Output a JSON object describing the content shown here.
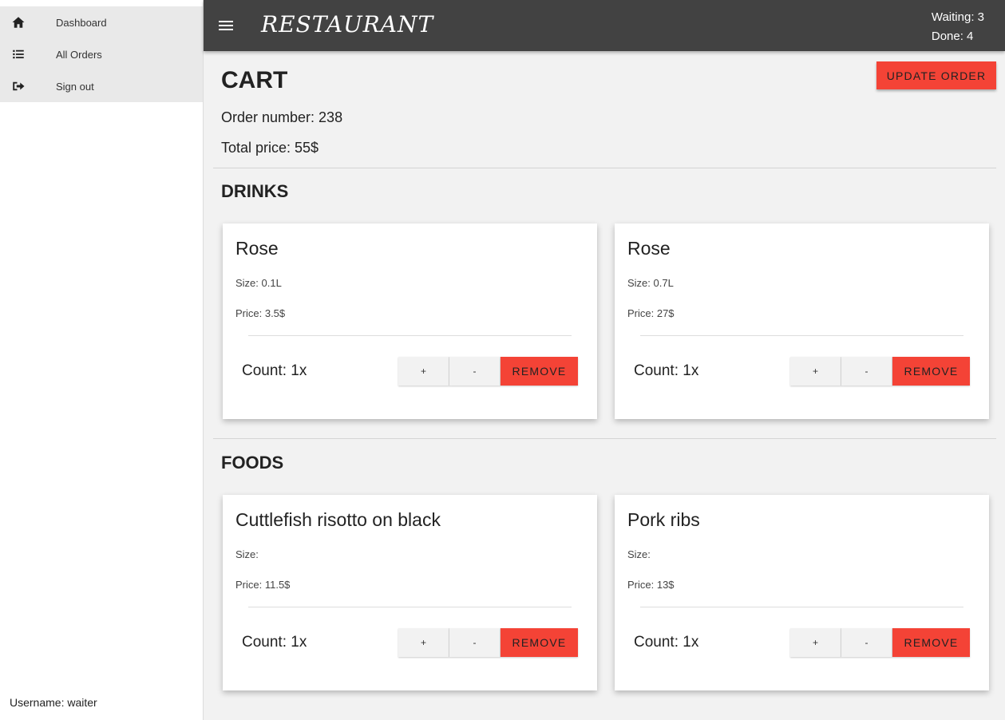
{
  "sidebar": {
    "items": [
      {
        "label": "Dashboard",
        "icon": "home-icon"
      },
      {
        "label": "All Orders",
        "icon": "list-icon"
      },
      {
        "label": "Sign out",
        "icon": "sign-out-icon"
      }
    ],
    "username": "Username: waiter"
  },
  "header": {
    "brand": "RESTAURANT",
    "waiting": "Waiting: 3",
    "done": "Done: 4"
  },
  "cart": {
    "title": "CART",
    "update_label": "UPDATE ORDER",
    "order_number": "Order number: 238",
    "total_price": "Total price: 55$"
  },
  "drinks": {
    "title": "DRINKS",
    "items": [
      {
        "name": "Rose",
        "size": "Size: 0.1L",
        "price": "Price: 3.5$",
        "count": "Count: 1x"
      },
      {
        "name": "Rose",
        "size": "Size: 0.7L",
        "price": "Price: 27$",
        "count": "Count: 1x"
      }
    ]
  },
  "foods": {
    "title": "FOODS",
    "items": [
      {
        "name": "Cuttlefish risotto on black",
        "size": "Size:",
        "price": "Price: 11.5$",
        "count": "Count: 1x"
      },
      {
        "name": "Pork ribs",
        "size": "Size:",
        "price": "Price: 13$",
        "count": "Count: 1x"
      }
    ]
  },
  "buttons": {
    "plus": "+",
    "minus": "-",
    "remove": "REMOVE"
  },
  "colors": {
    "accent": "#f44336",
    "topbar": "#424242",
    "background": "#f2f2f2"
  }
}
